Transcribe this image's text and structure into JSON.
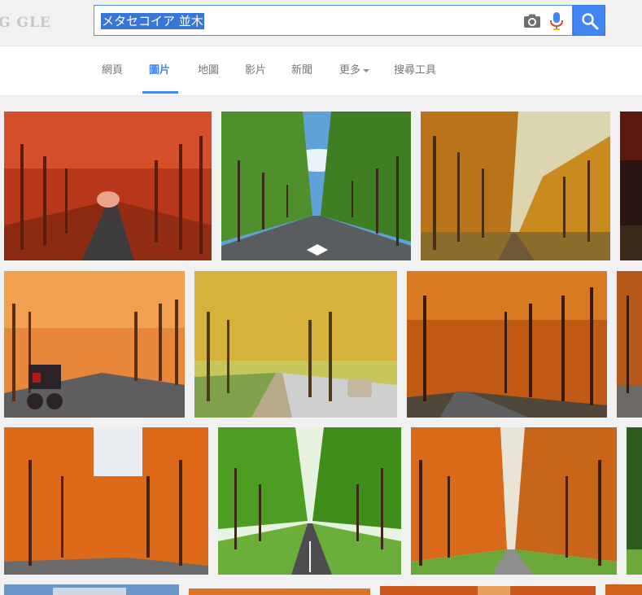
{
  "header": {
    "logo_text": "G  GLE",
    "search_query": "メタセコイア 並木",
    "icons": [
      "camera-icon",
      "microphone-icon",
      "search-icon"
    ]
  },
  "tabs": [
    {
      "label": "網頁",
      "active": false
    },
    {
      "label": "圖片",
      "active": true
    },
    {
      "label": "地圖",
      "active": false
    },
    {
      "label": "影片",
      "active": false
    },
    {
      "label": "新聞",
      "active": false
    },
    {
      "label": "更多",
      "active": false
    },
    {
      "label": "搜尋工具",
      "active": false
    }
  ],
  "colors": {
    "accent": "#4285f4",
    "selection": "#3875d7",
    "header_bg": "#f1f1f1"
  }
}
